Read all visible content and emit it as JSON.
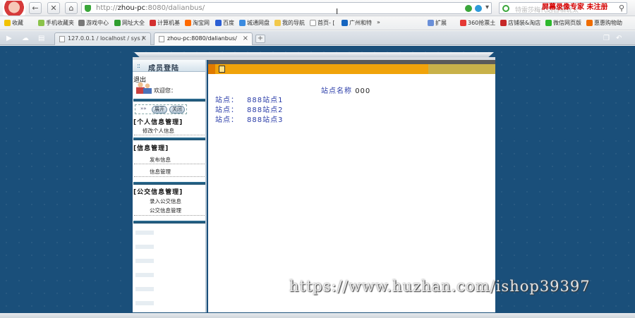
{
  "browser": {
    "url_prefix": "http://",
    "url_host": "zhou-pc",
    "url_rest": ":8080/dalianbus/",
    "search_hint": "特雷莎梅代选首相说太",
    "watermark_top": "屏幕录像专家 未注册",
    "bookmarks": [
      "收藏",
      "手机收藏夹",
      "游戏中心",
      "网址大全",
      "计算机基",
      "淘宝网",
      "百度",
      "城通网盘",
      "我的导航",
      "首页- [",
      "广州和特",
      "»",
      "扩展",
      "360抢票土",
      "店铺装&淘店",
      "微信网页版",
      "惠惠购物助"
    ],
    "tabs": [
      {
        "label": "127.0.0.1 / localhost / sys /",
        "active": false
      },
      {
        "label": "zhou-pc:8080/dalianbus/",
        "active": true
      }
    ],
    "tab_add": "+"
  },
  "sidebar": {
    "title": "成员登陆",
    "title_dots": "::",
    "logout": "退出",
    "welcome": "欢迎您：",
    "arrows": "»»",
    "btn_open": "展开",
    "btn_close": "关闭",
    "sections": [
      {
        "title": "[个人信息管理]",
        "items": [
          "修改个人信息"
        ]
      },
      {
        "title": "[信息管理]",
        "items": [
          "发布信息",
          "信息管理"
        ]
      },
      {
        "title": "[公交信息管理]",
        "items": [
          "录入公交信息",
          "公交信息管理"
        ]
      }
    ]
  },
  "main": {
    "title_label": "站点名称",
    "title_value": "000",
    "rows": [
      {
        "label": "站点：",
        "value": "888站点1"
      },
      {
        "label": "站点：",
        "value": "888站点2"
      },
      {
        "label": "站点：",
        "value": "888站点3"
      }
    ]
  },
  "watermark_bottom": "https://www.huzhan.com/ishop39397",
  "icons": {
    "back": "←",
    "close": "✕",
    "home": "⌂",
    "dropdown": "▾",
    "search": "⚲",
    "doc": "doc-icon"
  }
}
